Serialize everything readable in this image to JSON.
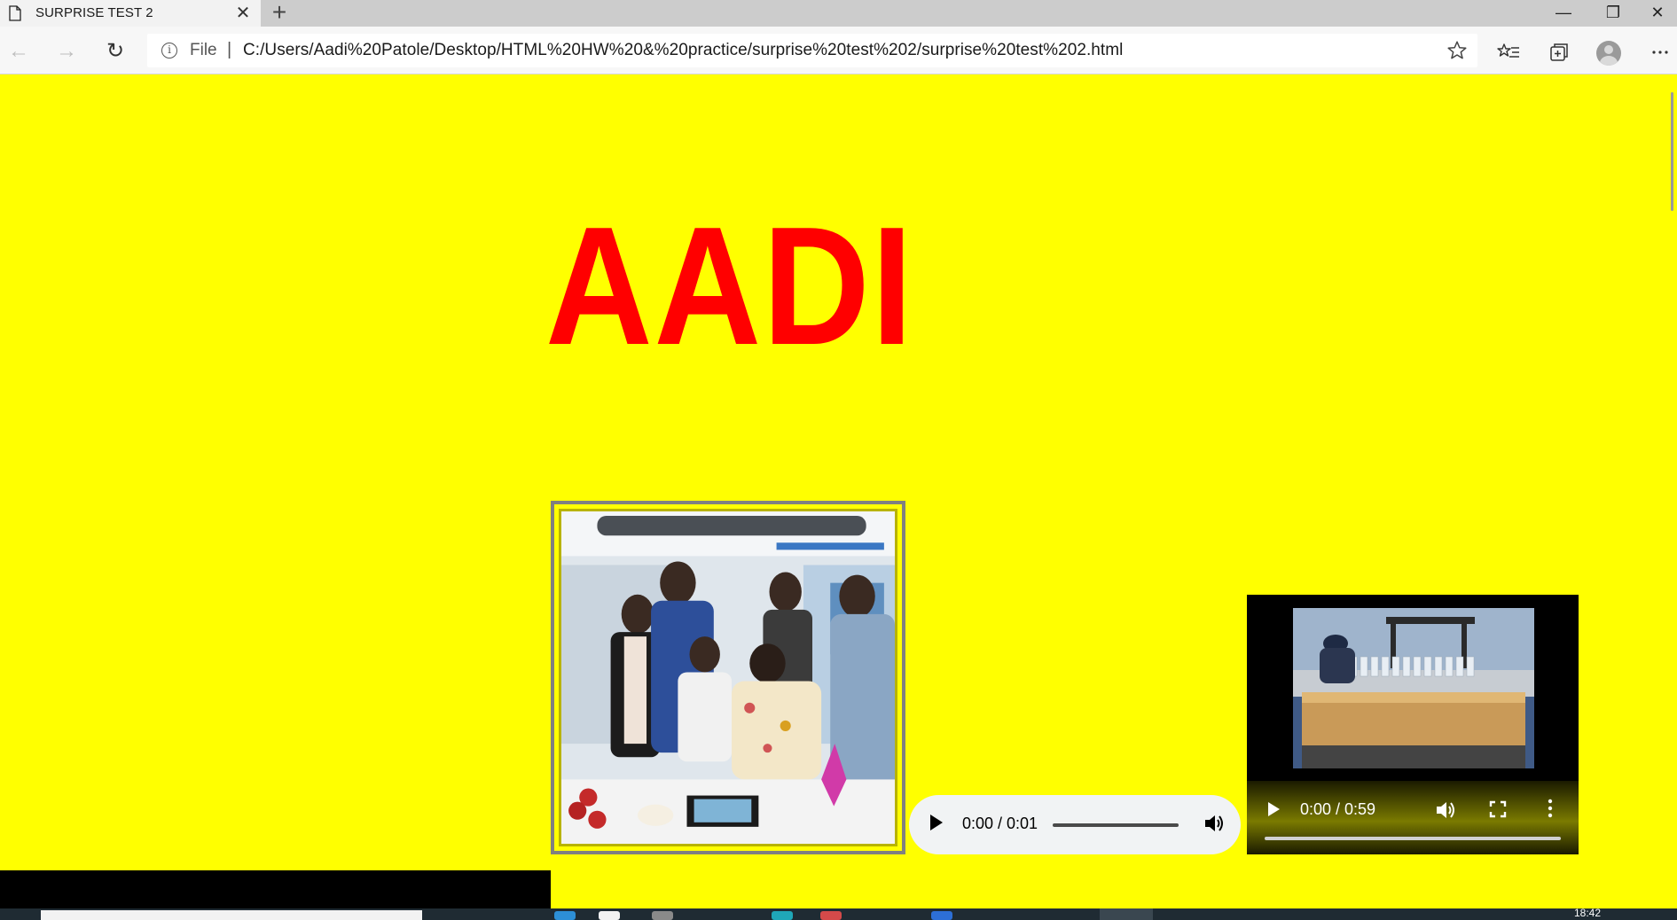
{
  "browser": {
    "tab_title": "SURPRISE TEST 2",
    "tab_close": "✕",
    "new_tab": "+",
    "window_controls": {
      "minimize": "—",
      "maximize": "❐",
      "close": "✕"
    },
    "nav": {
      "back": "←",
      "forward": "→",
      "reload": "↻"
    },
    "address": {
      "info_icon": "i",
      "scheme_label": "File",
      "separator": "|",
      "url": "C:/Users/Aadi%20Patole/Desktop/HTML%20HW%20&%20practice/surprise%20test%202/surprise%20test%202.html"
    },
    "toolbar_icons": [
      "star-icon",
      "favorites-icon",
      "collections-icon",
      "profile-avatar",
      "more-icon"
    ]
  },
  "page": {
    "background_color": "#ffff00",
    "heading": "AADI",
    "heading_color": "#ff0000",
    "photo": {
      "frame_color": "#808080"
    },
    "audio": {
      "time": "0:00 / 0:01"
    },
    "video": {
      "time": "0:00 / 0:59"
    }
  },
  "taskbar": {
    "clock": "18:42"
  }
}
